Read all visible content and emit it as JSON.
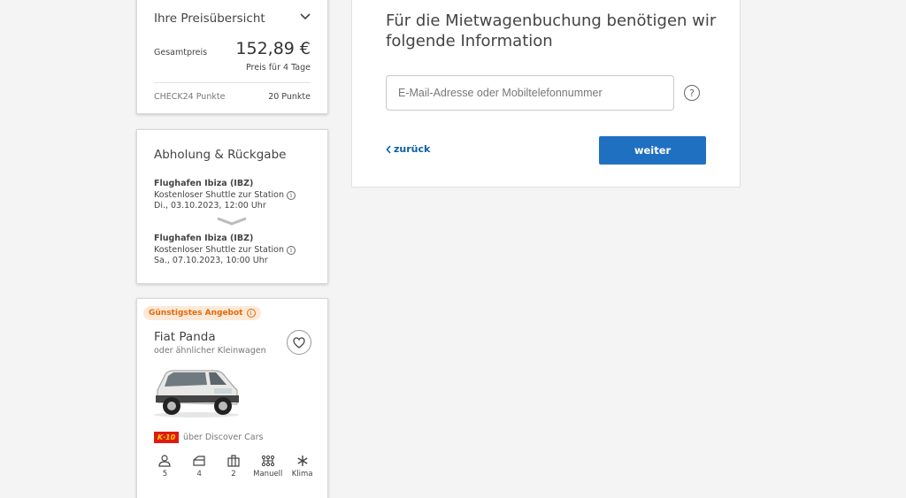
{
  "price_overview": {
    "title": "Ihre Preisübersicht",
    "total_label": "Gesamtpreis",
    "total_value": "152,89 €",
    "duration": "Preis für 4 Tage",
    "points_label": "CHECK24 Punkte",
    "points_value": "20 Punkte"
  },
  "pickup_return": {
    "title": "Abholung & Rückgabe",
    "pickup": {
      "location": "Flughafen Ibiza (IBZ)",
      "shuttle": "Kostenloser Shuttle zur Station",
      "datetime": "Di., 03.10.2023, 12:00 Uhr"
    },
    "return": {
      "location": "Flughafen Ibiza (IBZ)",
      "shuttle": "Kostenloser Shuttle zur Station",
      "datetime": "Sa., 07.10.2023, 10:00 Uhr"
    }
  },
  "car": {
    "badge": "Günstigstes Angebot",
    "name": "Fiat Panda",
    "subtitle": "oder ähnlicher Kleinwagen",
    "provider_logo": "K·10",
    "provider_text": "über Discover Cars",
    "features": [
      {
        "icon": "person-icon",
        "label": "5"
      },
      {
        "icon": "door-icon",
        "label": "4"
      },
      {
        "icon": "luggage-icon",
        "label": "2"
      },
      {
        "icon": "gearshift-icon",
        "label": "Manuell"
      },
      {
        "icon": "snowflake-icon",
        "label": "Klima"
      }
    ]
  },
  "form": {
    "heading": "Für die Mietwagenbuchung benötigen wir folgende Information",
    "input_placeholder": "E-Mail-Adresse oder Mobiltelefonnummer",
    "input_value": "",
    "back_label": "zurück",
    "next_label": "weiter"
  },
  "colors": {
    "primary": "#1f70c1",
    "link": "#0b5fa5",
    "badge_bg": "#fde9d6",
    "badge_text": "#e06a10",
    "background": "#f4f4f4"
  }
}
